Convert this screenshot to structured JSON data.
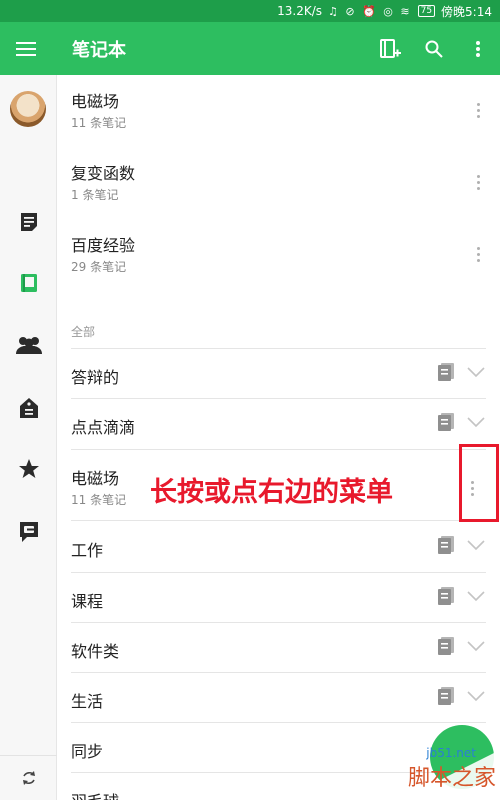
{
  "status_bar": {
    "speed": "13.2K/s",
    "icons": "♫ ⊘ ⏰ ◎ ≋",
    "battery": "75",
    "time": "傍晚5:14"
  },
  "app_bar": {
    "title": "笔记本"
  },
  "top_notebooks": [
    {
      "name": "电磁场",
      "count": "11 条笔记"
    },
    {
      "name": "复变函数",
      "count": "1 条笔记"
    },
    {
      "name": "百度经验",
      "count": "29 条笔记"
    }
  ],
  "section_label": "全部",
  "notebooks": [
    {
      "name": "答辩的",
      "count": ""
    },
    {
      "name": "点点滴滴",
      "count": ""
    },
    {
      "name": "电磁场",
      "count": "11 条笔记"
    },
    {
      "name": "工作",
      "count": ""
    },
    {
      "name": "课程",
      "count": ""
    },
    {
      "name": "软件类",
      "count": ""
    },
    {
      "name": "生活",
      "count": ""
    },
    {
      "name": "同步",
      "count": ""
    },
    {
      "name": "羽毛球",
      "count": ""
    }
  ],
  "annotation": "长按或点右边的菜单",
  "watermark": {
    "url": "jb51.net",
    "text": "脚本之家"
  },
  "colors": {
    "accent": "#2dbe60",
    "status_bar": "#1e9e4a",
    "annotation": "#e8192c"
  }
}
